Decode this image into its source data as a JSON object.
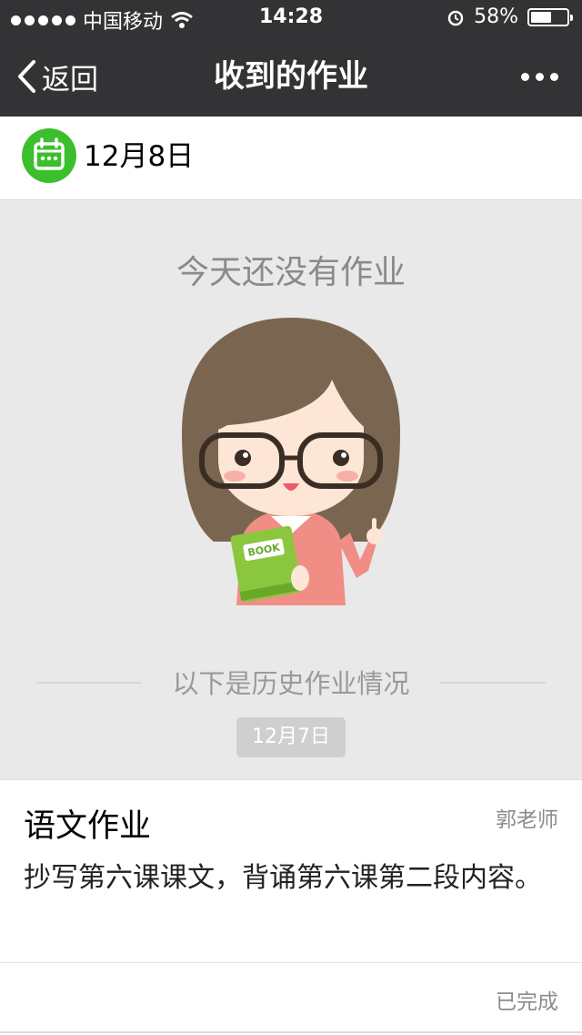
{
  "status_bar": {
    "carrier": "中国移动",
    "time": "14:28",
    "battery_text": "58%",
    "battery_level": 0.58
  },
  "nav": {
    "back_label": "返回",
    "title": "收到的作业"
  },
  "date_bar": {
    "date": "12月8日"
  },
  "empty_state": {
    "message": "今天还没有作业",
    "book_label": "BOOK"
  },
  "history": {
    "divider_text": "以下是历史作业情况",
    "date_badge": "12月7日",
    "items": [
      {
        "subject": "语文作业",
        "teacher": "郭老师",
        "content": "抄写第六课课文，背诵第六课第二段内容。",
        "status": "已完成"
      }
    ]
  },
  "colors": {
    "accent_green": "#3cbf2c",
    "nav_bg": "#333336",
    "page_bg": "#e9e9e9"
  }
}
